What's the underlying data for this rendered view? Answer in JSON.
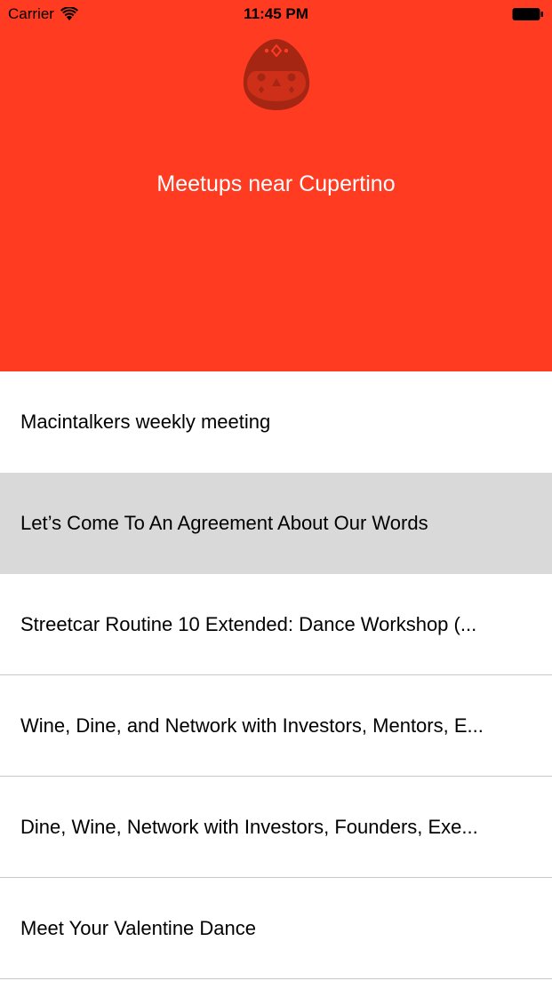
{
  "status_bar": {
    "carrier": "Carrier",
    "time": "11:45 PM"
  },
  "header": {
    "title": "Meetups near Cupertino",
    "background_color": "#ff3b22",
    "logo_icon": "mascot-icon"
  },
  "meetups": [
    {
      "name": "Macintalkers weekly meeting",
      "selected": false
    },
    {
      "name": "Let’s Come To An Agreement About Our Words",
      "selected": true
    },
    {
      "name": "Streetcar Routine 10 Extended: Dance Workshop (...",
      "selected": false
    },
    {
      "name": "Wine, Dine, and Network with Investors, Mentors, E...",
      "selected": false
    },
    {
      "name": "Dine, Wine, Network with Investors, Founders, Exe...",
      "selected": false
    },
    {
      "name": "Meet Your Valentine Dance",
      "selected": false
    }
  ]
}
